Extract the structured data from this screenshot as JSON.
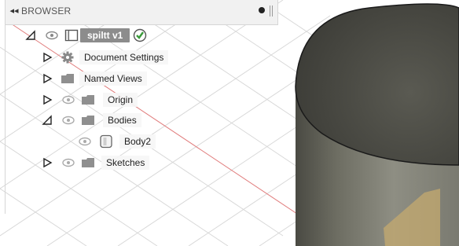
{
  "browser": {
    "title": "BROWSER",
    "collapse_glyph": "◂◂",
    "pin_icon": "pin-icon"
  },
  "tree": {
    "root": {
      "label": "spiltt v1",
      "expanded": true,
      "visible": true,
      "status_icon": "check-badge-icon"
    },
    "items": [
      {
        "label": "Document Settings",
        "icon": "gear-icon",
        "expanded": false,
        "has_eye": false
      },
      {
        "label": "Named Views",
        "icon": "folder-icon",
        "expanded": false,
        "has_eye": false
      },
      {
        "label": "Origin",
        "icon": "folder-icon",
        "expanded": false,
        "has_eye": true
      },
      {
        "label": "Bodies",
        "icon": "folder-icon",
        "expanded": true,
        "has_eye": true
      },
      {
        "label": "Body2",
        "icon": "body-icon",
        "expanded": null,
        "has_eye": true
      },
      {
        "label": "Sketches",
        "icon": "folder-icon",
        "expanded": false,
        "has_eye": true
      }
    ]
  },
  "colors": {
    "accent_red_axis": "#e07a7a",
    "cylinder_dark": "#3f3f3a",
    "cylinder_mid": "#76766a",
    "cylinder_light": "#9c9c90",
    "face_highlight": "#c4a96f"
  }
}
